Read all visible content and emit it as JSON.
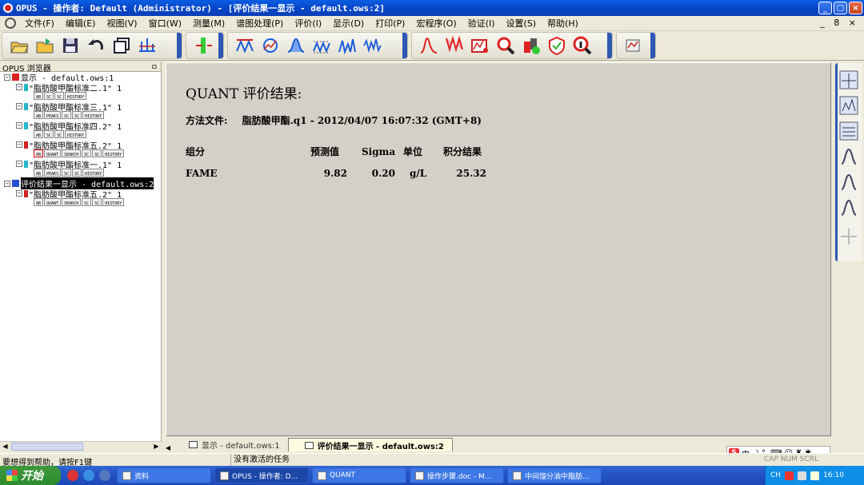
{
  "window": {
    "title": "OPUS - 操作者: Default  (Administrator) - [评价结果一显示 - default.ows:2]",
    "minimize": "_",
    "maximize": "□",
    "close": "×"
  },
  "menu": {
    "items": [
      "文件(F)",
      "编辑(E)",
      "视图(V)",
      "窗口(W)",
      "测量(M)",
      "谱图处理(P)",
      "评价(I)",
      "显示(D)",
      "打印(P)",
      "宏程序(O)",
      "验证(I)",
      "设置(S)",
      "帮助(H)"
    ],
    "mdi_controls": "_ 8 ×"
  },
  "browser": {
    "header": "OPUS 浏览器",
    "pin": "ㅁ",
    "root1": "显示 - default.ows:1",
    "root2": "评价结果一显示 - default.ows:2",
    "files1": [
      {
        "label": "\"脂肪酸甲酯标准二.1\" 1",
        "color": "#26b7c8",
        "blocks": [
          "AB",
          "SC",
          "SC",
          "HISTORY"
        ]
      },
      {
        "label": "\"脂肪酸甲酯标准三.1\" 1",
        "color": "#26b7c8",
        "blocks": [
          "AB",
          "PEAKS",
          "SC",
          "SC",
          "HISTORY"
        ]
      },
      {
        "label": "\"脂肪酸甲酯标准四.2\" 1",
        "color": "#26b7c8",
        "blocks": [
          "AB",
          "SC",
          "SC",
          "HISTORY"
        ]
      },
      {
        "label": "\"脂肪酸甲酯标准五.2\" 1",
        "color": "#d22020",
        "blocks": [
          "AB",
          "QUANT",
          "SEARCH",
          "SC",
          "SC",
          "HISTORY"
        ]
      },
      {
        "label": "\"脂肪酸甲酯标准一.1\" 1",
        "color": "#26b7c8",
        "blocks": [
          "AB",
          "PEAKS",
          "SC",
          "SC",
          "HISTORY"
        ]
      }
    ],
    "files2": [
      {
        "label": "\"脂肪酸甲酯标准五.2\" 1",
        "color": "#d22020",
        "blocks": [
          "AB",
          "QUANT",
          "SEARCH",
          "SC",
          "SC",
          "HISTORY"
        ]
      }
    ]
  },
  "report": {
    "title": "QUANT 评价结果:",
    "method_label": "方法文件:",
    "method_value": "脂肪酸甲酯.q1 - 2012/04/07 16:07:32 (GMT+8)",
    "headers": [
      "组分",
      "预测值",
      "Sigma",
      "单位",
      "积分结果"
    ],
    "rows": [
      {
        "component": "FAME",
        "predicted": "9.82",
        "sigma": "0.20",
        "unit": "g/L",
        "integral": "25.32"
      }
    ]
  },
  "tabs": [
    {
      "label": "显示 - default.ows:1",
      "active": false
    },
    {
      "label": "评价结果一显示 - default.ows:2",
      "active": true
    }
  ],
  "status": {
    "help": "要想得到帮助，请按F1键",
    "task": "没有激活的任务",
    "keys": "CAP NUM SCRL"
  },
  "ime": {
    "label": "中",
    "extra": "°,"
  },
  "taskbar": {
    "start": "开始",
    "tasks": [
      {
        "label": "资料",
        "active": false,
        "width": 118
      },
      {
        "label": "OPUS - 操作者: D...",
        "active": true,
        "width": 118
      },
      {
        "label": "QUANT",
        "active": false,
        "width": 118
      },
      {
        "label": "操作步骤.doc - M...",
        "active": false,
        "width": 118
      },
      {
        "label": "中间馏分油中脂肪...",
        "active": false,
        "width": 118
      }
    ],
    "tray_lang": "CH",
    "clock": "16:10"
  }
}
